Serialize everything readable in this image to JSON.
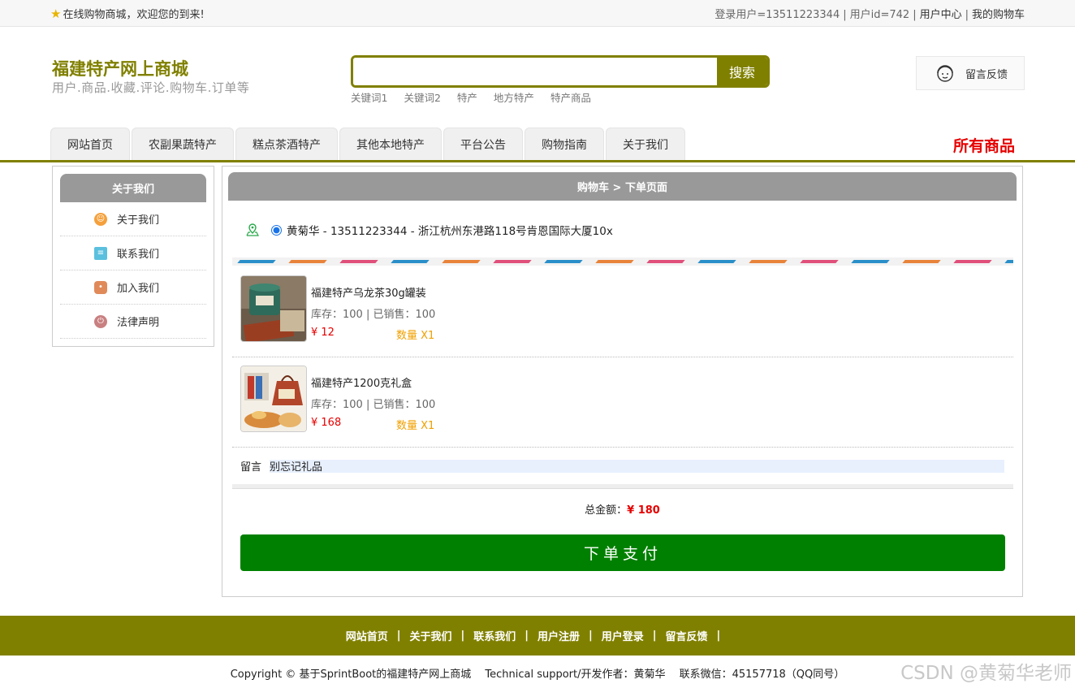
{
  "topbar": {
    "welcome": "在线购物商城，欢迎您的到来!",
    "links": [
      "登录用户=13511223344",
      "用户id=742",
      "用户中心",
      "我的购物车"
    ]
  },
  "header": {
    "title": "福建特产网上商城",
    "subtitle": "用户.商品.收藏.评论.购物车.订单等",
    "search_placeholder": "",
    "search_button": "搜索",
    "keywords": [
      "关键词1",
      "关键词2",
      "特产",
      "地方特产",
      "特产商品"
    ],
    "feedback": "留言反馈"
  },
  "nav": {
    "tabs": [
      "网站首页",
      "农副果蔬特产",
      "糕点茶酒特产",
      "其他本地特产",
      "平台公告",
      "购物指南",
      "关于我们"
    ],
    "all_goods": "所有商品"
  },
  "sidebar": {
    "title": "关于我们",
    "items": [
      {
        "label": "关于我们",
        "icon": "about-icon",
        "color": "#f5a03c"
      },
      {
        "label": "联系我们",
        "icon": "clipboard-icon",
        "color": "#5bc0de"
      },
      {
        "label": "加入我们",
        "icon": "lock-icon",
        "color": "#e08a5a"
      },
      {
        "label": "法律声明",
        "icon": "power-icon",
        "color": "#c98080"
      }
    ]
  },
  "order": {
    "breadcrumb": "购物车 > 下单页面",
    "address": "黄菊华 - 13511223344 - 浙江杭州东港路118号肯恩国际大厦10x",
    "items": [
      {
        "name": "福建特产乌龙茶30g罐装",
        "stock": "库存：100 | 已销售：100",
        "price": "¥ 12",
        "qty": "数量 X1"
      },
      {
        "name": "福建特产1200克礼盒",
        "stock": "库存：100 | 已销售：100",
        "price": "¥ 168",
        "qty": "数量 X1"
      }
    ],
    "note_label": "留言",
    "note_value": "别忘记礼品",
    "total_label": "总金额：",
    "total_value": "¥ 180",
    "pay_button": "下单支付"
  },
  "footer": {
    "links": [
      "网站首页",
      "关于我们",
      "联系我们",
      "用户注册",
      "用户登录",
      "留言反馈"
    ],
    "copyright": "Copyright © 基于SprintBoot的福建特产网上商城　 Technical support/开发作者：黄菊华　  联系微信：45157718（QQ同号）",
    "watermark": "CSDN @黄菊华老师"
  }
}
